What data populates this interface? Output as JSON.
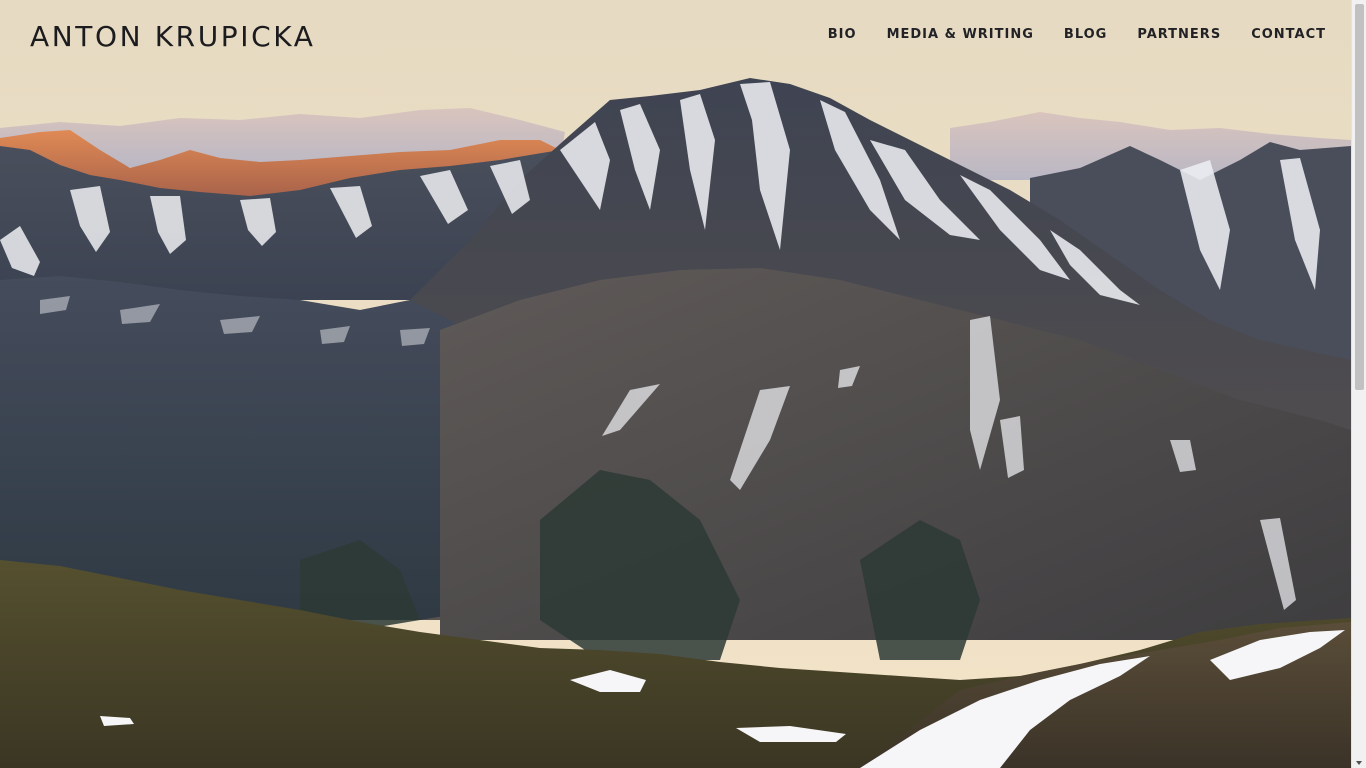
{
  "site": {
    "logo_text": "ANTON KRUPICKA"
  },
  "nav": {
    "items": [
      {
        "label": "BIO",
        "name": "nav-bio"
      },
      {
        "label": "MEDIA & WRITING",
        "name": "nav-media-writing"
      },
      {
        "label": "BLOG",
        "name": "nav-blog"
      },
      {
        "label": "PARTNERS",
        "name": "nav-partners"
      },
      {
        "label": "CONTACT",
        "name": "nav-contact"
      }
    ]
  },
  "colors": {
    "sky_top": "#e8dcc3",
    "sky_bottom": "#f2e3c6",
    "text": "#1c1c1f",
    "alpenglow": "#c86a3a",
    "rock": "#3a3f4c",
    "snow": "#f4f4f6",
    "meadow": "#4a4630"
  }
}
